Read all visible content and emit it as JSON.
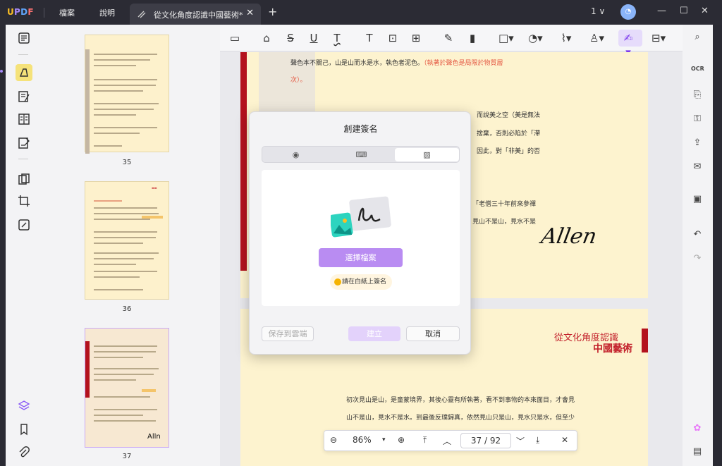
{
  "app": {
    "logo": "UPDF",
    "menu": [
      "檔案",
      "說明"
    ],
    "tab_title": "從文化角度認識中國藝術*",
    "page_count_badge": "1 ∨"
  },
  "thumbnails": [
    {
      "label": "35"
    },
    {
      "label": "36"
    },
    {
      "label": "37"
    }
  ],
  "page1": {
    "lines": [
      "聲色本不關己，山是山而水是水，執色者泥色。",
      "次）。",
      "而說美之空（美是無法",
      "捨棄，否則必陷於「滯",
      "因此，對「非美」的否",
      "「老僧三十年前來參禪",
      "見山不是山，見水不是"
    ],
    "annotation": "（執著於聲色是局限於物質層",
    "annotation2": "美是無法",
    "signature": "Allen"
  },
  "page2": {
    "title1": "從文化角度認識",
    "title2": "中國藝術",
    "body": [
      "初次見山是山，是童蒙境界，其後心靈有所執著，看不到事物的本來面目，才會見",
      "山不是山，見水不是水。到最後反璞歸真，依然見山只是山，見水只是水，但至少"
    ]
  },
  "zoom": {
    "value": "86%",
    "page_current": "37",
    "page_total": "92",
    "page_sep": "/"
  },
  "dialog": {
    "title": "創建簽名",
    "choose_file": "選擇檔案",
    "hint": "請在白紙上簽名",
    "save_label": "保存到雲端",
    "create_label": "建立",
    "cancel_label": "取消"
  }
}
